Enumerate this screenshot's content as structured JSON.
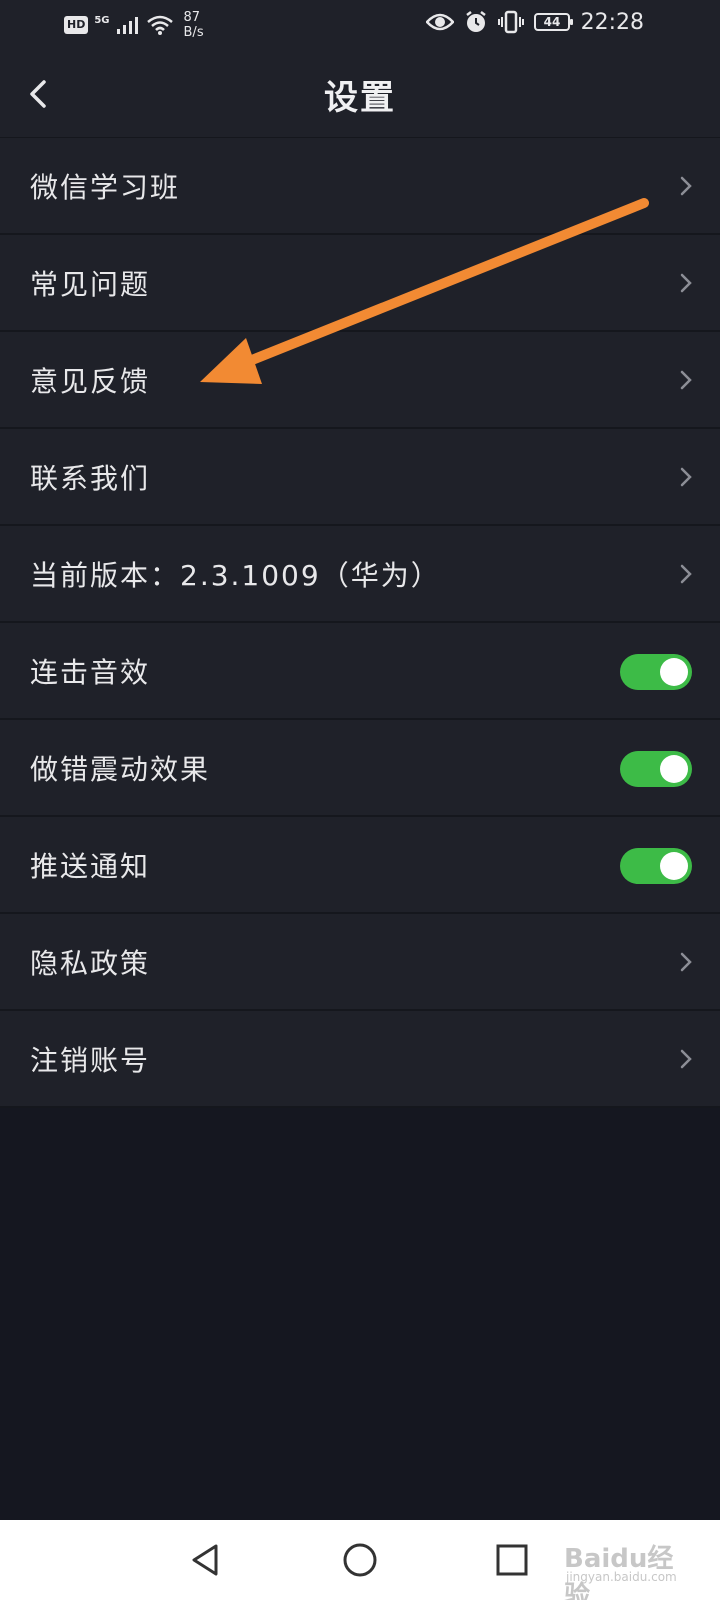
{
  "status_bar": {
    "hd": "HD",
    "network": "5G",
    "speed_value": "87",
    "speed_unit": "B/s",
    "battery": "44",
    "time": "22:28"
  },
  "header": {
    "title": "设置"
  },
  "settings": [
    {
      "label": "微信学习班",
      "control": "chevron"
    },
    {
      "label": "常见问题",
      "control": "chevron"
    },
    {
      "label": "意见反馈",
      "control": "chevron"
    },
    {
      "label": "联系我们",
      "control": "chevron"
    },
    {
      "label": "当前版本：2.3.1009（华为）",
      "control": "chevron"
    },
    {
      "label": "连击音效",
      "control": "toggle",
      "on": true
    },
    {
      "label": "做错震动效果",
      "control": "toggle",
      "on": true
    },
    {
      "label": "推送通知",
      "control": "toggle",
      "on": true
    },
    {
      "label": "隐私政策",
      "control": "chevron"
    },
    {
      "label": "注销账号",
      "control": "chevron"
    }
  ],
  "colors": {
    "background": "#151720",
    "row": "#1f2129",
    "toggle_on": "#3dbb47",
    "annotation_arrow": "#f28a33"
  },
  "watermark": {
    "text": "Baidu经验",
    "sub": "jingyan.baidu.com"
  }
}
